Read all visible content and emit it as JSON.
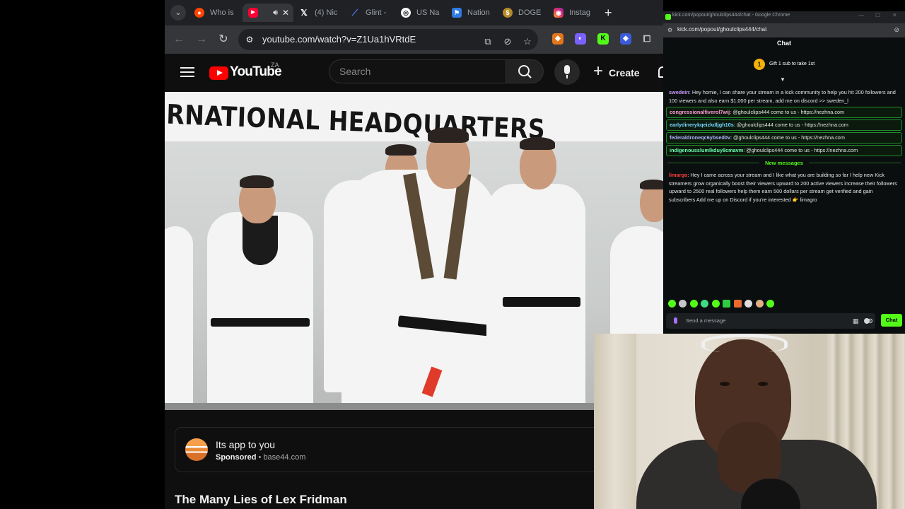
{
  "browser": {
    "tabs": [
      {
        "label": "Who is",
        "icon": "reddit-icon",
        "color": "#ff4500"
      },
      {
        "label": "",
        "icon": "youtube-icon",
        "color": "#ff0033",
        "active": true
      },
      {
        "label": "(4) Nic",
        "icon": "x-icon",
        "color": "#000000"
      },
      {
        "label": "Glint -",
        "icon": "glint-icon",
        "color": "#4e7cff"
      },
      {
        "label": "US Na",
        "icon": "globe-icon",
        "color": "#ffffff"
      },
      {
        "label": "Nation",
        "icon": "flag-icon",
        "color": "#2f7ae5"
      },
      {
        "label": "DOGE",
        "icon": "doge-coin-icon",
        "color": "#b58a2a"
      },
      {
        "label": "Instag",
        "icon": "instagram-icon",
        "color": "#e1306c"
      }
    ],
    "url": "youtube.com/watch?v=Z1Ua1hVRtdE"
  },
  "youtube": {
    "logo_text": "YouTube",
    "country_code": "ZA",
    "search_placeholder": "Search",
    "create_label": "Create",
    "video_banner_text": "ERNATIONAL HEADQUARTERS",
    "sponsor": {
      "title": "Its app to you",
      "label": "Sponsored",
      "domain": "base44.com"
    },
    "video_title": "The Many Lies of Lex Fridman"
  },
  "kick": {
    "window_title": "kick.com/popout/ghoulclips444/chat - Google Chrome",
    "url": "kick.com/popout/ghoulclips444/chat",
    "chat_title": "Chat",
    "gift_text": "Gift 1 sub to take 1st",
    "messages": [
      {
        "user": "swedein",
        "color": "#c89bff",
        "text": "Hey homie, I can share your stream in a kick community to help you hit 200 followers and 100 viewers and also earn $1,000 per stream, add me on discord >> sweden_l",
        "highlight": false
      },
      {
        "user": "congressionalfiverol7wij",
        "color": "#ff9ad5",
        "text": "@ghoulclips444 come to us - https://nezhna.com",
        "highlight": true
      },
      {
        "user": "earlydinerykqeizkdljgh10s",
        "color": "#7ad7ff",
        "text": "@ghoulclips444 come to us - https://nezhna.com",
        "highlight": true
      },
      {
        "user": "federaldroneqc6ybsed0v",
        "color": "#b3b3ff",
        "text": "@ghoulclips444 come to us - https://nezhna.com",
        "highlight": true
      },
      {
        "user": "indigenousslumlkduy8cmavm",
        "color": "#6dffb0",
        "text": "@ghoulclips444 come to us - https://nezhna.com",
        "highlight": true
      },
      {
        "user": "limargo",
        "color": "#ff3b3b",
        "text": "Hey I came across your stream and I like what you are building so far I help new Kick streamers grow organically boost their viewers upward to 200 active viewers increase their followers upward to 2500 real followers help them earn 500 dollars per stream get verified and gain subscribers Add me up on Discord if you're interested 👉 limagro",
        "highlight": false
      }
    ],
    "new_messages_label": "New messages",
    "send_placeholder": "Send a message",
    "chat_button": "Chat"
  },
  "colors": {
    "kick_green": "#53fc18",
    "youtube_red": "#ff0000",
    "chrome_dark": "#202124",
    "chrome_toolbar": "#35363a"
  }
}
